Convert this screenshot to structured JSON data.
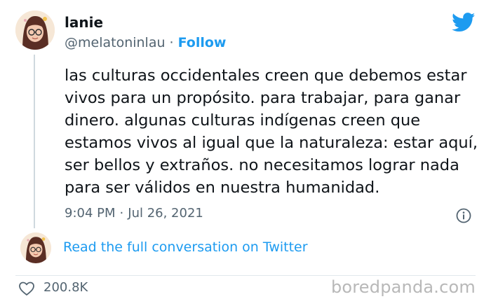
{
  "author": {
    "display_name": "lanie",
    "handle": "@melatoninlau",
    "separator": "·",
    "follow_label": "Follow",
    "avatar_icon": "avatar-illustration"
  },
  "tweet": {
    "text": "las culturas occidentales creen que debemos estar vivos para un propósito. para trabajar, para ganar dinero. algunas culturas indígenas creen que estamos vivos al igual que la naturaleza: estar aquí, ser bellos y extraños. no necesitamos lograr nada para ser válidos en nuestra humanidad.",
    "time": "9:04 PM",
    "separator": "·",
    "date": "Jul 26, 2021"
  },
  "conversation": {
    "link_label": "Read the full conversation on Twitter"
  },
  "engagement": {
    "likes": "200.8K",
    "like_icon": "heart-icon"
  },
  "branding": {
    "twitter_icon": "twitter-bird-icon",
    "watermark": "boredpanda.com"
  },
  "colors": {
    "accent": "#1d9bf0",
    "text": "#0f1419",
    "muted": "#536471",
    "watermark": "#b8b8b8"
  }
}
